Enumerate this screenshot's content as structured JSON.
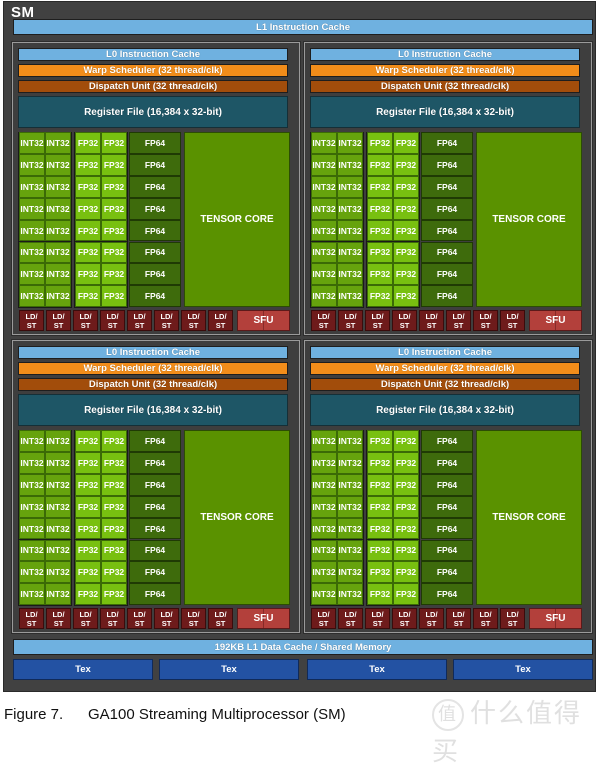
{
  "diagram": {
    "sm_label": "SM",
    "l1_instruction_cache": "L1 Instruction Cache",
    "partitions": [
      {
        "l0_cache": "L0 Instruction Cache",
        "warp_scheduler": "Warp Scheduler (32 thread/clk)",
        "dispatch_unit": "Dispatch Unit (32 thread/clk)",
        "register_file": "Register File (16,384 x 32-bit)",
        "int32_label": "INT32",
        "fp32_label": "FP32",
        "fp64_label": "FP64",
        "tensor_core": "TENSOR CORE",
        "ldst_label_top": "LD/",
        "ldst_label_bottom": "ST",
        "sfu": "SFU"
      },
      {
        "l0_cache": "L0 Instruction Cache",
        "warp_scheduler": "Warp Scheduler (32 thread/clk)",
        "dispatch_unit": "Dispatch Unit (32 thread/clk)",
        "register_file": "Register File (16,384 x 32-bit)",
        "int32_label": "INT32",
        "fp32_label": "FP32",
        "fp64_label": "FP64",
        "tensor_core": "TENSOR CORE",
        "ldst_label_top": "LD/",
        "ldst_label_bottom": "ST",
        "sfu": "SFU"
      },
      {
        "l0_cache": "L0 Instruction Cache",
        "warp_scheduler": "Warp Scheduler (32 thread/clk)",
        "dispatch_unit": "Dispatch Unit (32 thread/clk)",
        "register_file": "Register File (16,384 x 32-bit)",
        "int32_label": "INT32",
        "fp32_label": "FP32",
        "fp64_label": "FP64",
        "tensor_core": "TENSOR CORE",
        "ldst_label_top": "LD/",
        "ldst_label_bottom": "ST",
        "sfu": "SFU"
      },
      {
        "l0_cache": "L0 Instruction Cache",
        "warp_scheduler": "Warp Scheduler (32 thread/clk)",
        "dispatch_unit": "Dispatch Unit (32 thread/clk)",
        "register_file": "Register File (16,384 x 32-bit)",
        "int32_label": "INT32",
        "fp32_label": "FP32",
        "fp64_label": "FP64",
        "tensor_core": "TENSOR CORE",
        "ldst_label_top": "LD/",
        "ldst_label_bottom": "ST",
        "sfu": "SFU"
      }
    ],
    "units_per_partition": {
      "int32_rows": 8,
      "int32_cols": 2,
      "fp32_rows": 8,
      "fp32_cols": 2,
      "fp64_rows": 8,
      "ldst_count": 8
    },
    "l1_data_cache": "192KB L1 Data Cache / Shared Memory",
    "tex_units": [
      "Tex",
      "Tex",
      "Tex",
      "Tex"
    ]
  },
  "caption": {
    "figure_number": "Figure 7.",
    "title": "GA100 Streaming Multiprocessor (SM)"
  },
  "watermark": {
    "badge": "值",
    "text": "什么值得买"
  },
  "colors": {
    "frame": "#414141",
    "cache": "#6fb1e0",
    "warp_scheduler": "#f28d1a",
    "dispatch_unit": "#a24d0b",
    "register_file": "#1e5666",
    "int32": "#66a30d",
    "fp32": "#78c010",
    "fp64": "#3e6b0c",
    "tensor_core": "#5a9200",
    "ldst": "#6e1b1b",
    "sfu": "#b3403b",
    "tex": "#2352a3"
  }
}
